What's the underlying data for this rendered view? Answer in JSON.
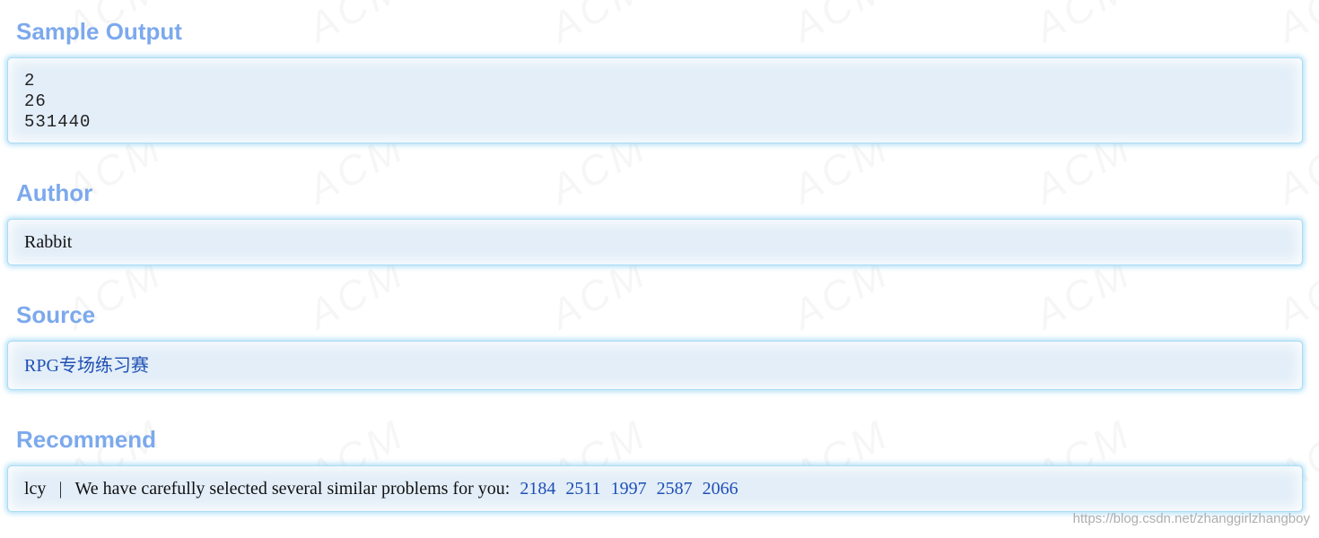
{
  "sample_output": {
    "title": "Sample Output",
    "lines": [
      "2",
      "26",
      "531440"
    ]
  },
  "author": {
    "title": "Author",
    "name": "Rabbit"
  },
  "source": {
    "title": "Source",
    "link_text": "RPG专场练习赛"
  },
  "recommend": {
    "title": "Recommend",
    "user": "lcy",
    "separator": "|",
    "message": "We have carefully selected several similar problems for you:",
    "problems": [
      "2184",
      "2511",
      "1997",
      "2587",
      "2066"
    ]
  },
  "watermark": {
    "text": "https://blog.csdn.net/zhanggirlzhangboy"
  },
  "colors": {
    "title": "#7ca9ed",
    "panel_bg": "#e3eef8",
    "panel_border": "#a9dcf4",
    "link": "#1f4fb5"
  }
}
